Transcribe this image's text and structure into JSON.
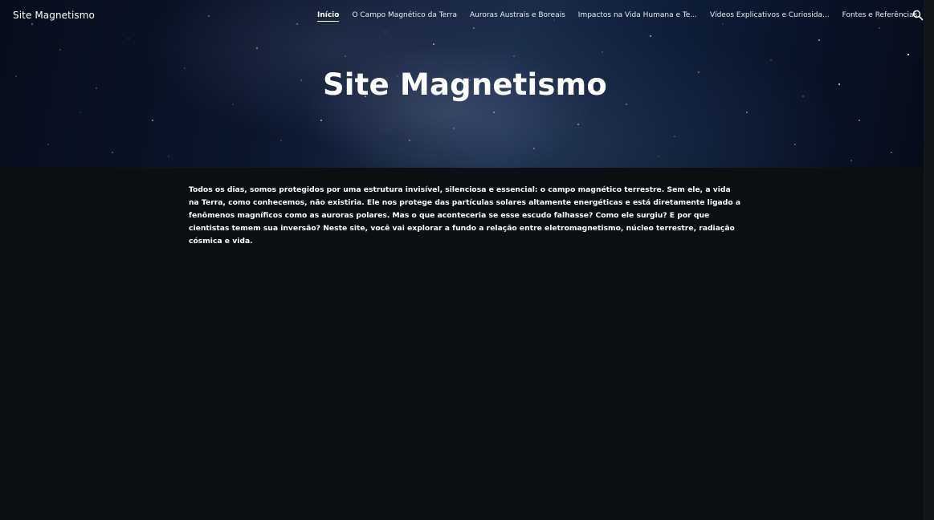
{
  "site": {
    "name": "Site Magnetismo"
  },
  "nav": {
    "items": [
      {
        "label": "Início",
        "active": true
      },
      {
        "label": "O Campo Magnético da Terra",
        "active": false
      },
      {
        "label": "Auroras Austrais e Boreais",
        "active": false
      },
      {
        "label": "Impactos na Vida Humana e Te...",
        "active": false
      },
      {
        "label": "Vídeos Explicativos e Curiosida...",
        "active": false
      },
      {
        "label": "Fontes e Referências",
        "active": false
      }
    ],
    "search_icon": "search-icon"
  },
  "hero": {
    "title": "Site Magnetismo"
  },
  "main": {
    "intro": "Todos os dias, somos protegidos por uma estrutura invisível, silenciosa e essencial: o campo magnético terrestre. Sem ele, a vida na Terra, como conhecemos, não existiria. Ele nos protege das partículas solares altamente energéticas e está diretamente ligado a fenômenos magníficos como as auroras polares. Mas o que aconteceria se esse escudo falhasse? Como ele surgiu? E por que cientistas temem sua inversão? Neste site, você vai explorar a fundo a relação entre eletromagnetismo, núcleo terrestre, radiação cósmica e vida."
  },
  "colors": {
    "page_background": "#0b0f12",
    "text": "#ffffff"
  }
}
